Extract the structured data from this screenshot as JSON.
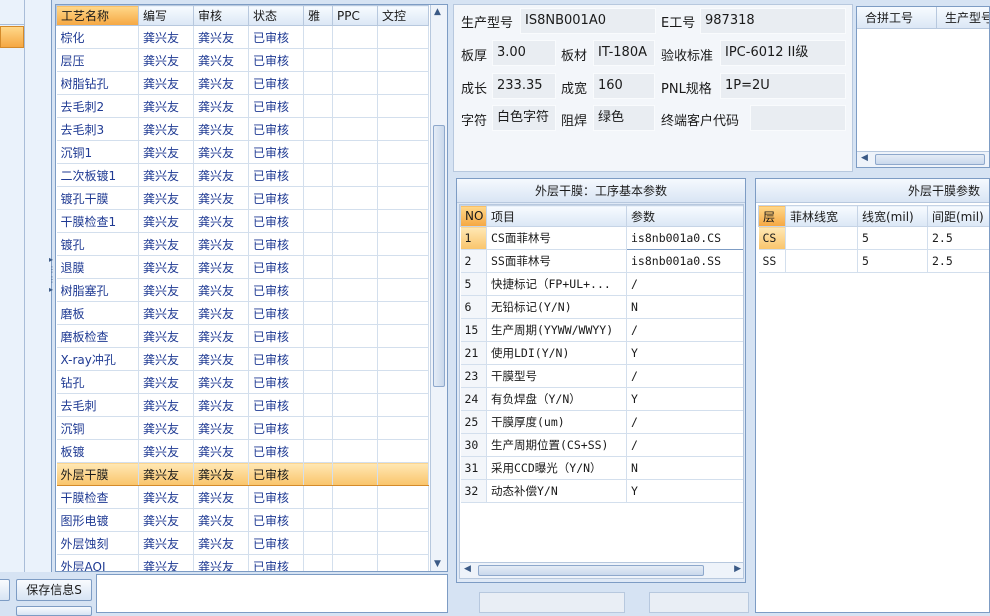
{
  "process_table": {
    "columns": [
      "工艺名称",
      "编写",
      "审核",
      "状态",
      "雅",
      "PPC",
      "文控"
    ],
    "rows": [
      {
        "name": "棕化",
        "writer": "龚兴友",
        "reviewer": "龚兴友",
        "status": "已审核"
      },
      {
        "name": "层压",
        "writer": "龚兴友",
        "reviewer": "龚兴友",
        "status": "已审核"
      },
      {
        "name": "树脂钻孔",
        "writer": "龚兴友",
        "reviewer": "龚兴友",
        "status": "已审核"
      },
      {
        "name": "去毛刺2",
        "writer": "龚兴友",
        "reviewer": "龚兴友",
        "status": "已审核"
      },
      {
        "name": "去毛刺3",
        "writer": "龚兴友",
        "reviewer": "龚兴友",
        "status": "已审核"
      },
      {
        "name": "沉铜1",
        "writer": "龚兴友",
        "reviewer": "龚兴友",
        "status": "已审核"
      },
      {
        "name": "二次板镀1",
        "writer": "龚兴友",
        "reviewer": "龚兴友",
        "status": "已审核"
      },
      {
        "name": "镀孔干膜",
        "writer": "龚兴友",
        "reviewer": "龚兴友",
        "status": "已审核"
      },
      {
        "name": "干膜检查1",
        "writer": "龚兴友",
        "reviewer": "龚兴友",
        "status": "已审核"
      },
      {
        "name": "镀孔",
        "writer": "龚兴友",
        "reviewer": "龚兴友",
        "status": "已审核"
      },
      {
        "name": "退膜",
        "writer": "龚兴友",
        "reviewer": "龚兴友",
        "status": "已审核"
      },
      {
        "name": "树脂塞孔",
        "writer": "龚兴友",
        "reviewer": "龚兴友",
        "status": "已审核"
      },
      {
        "name": "磨板",
        "writer": "龚兴友",
        "reviewer": "龚兴友",
        "status": "已审核"
      },
      {
        "name": "磨板检查",
        "writer": "龚兴友",
        "reviewer": "龚兴友",
        "status": "已审核"
      },
      {
        "name": "X-ray冲孔",
        "writer": "龚兴友",
        "reviewer": "龚兴友",
        "status": "已审核"
      },
      {
        "name": "钻孔",
        "writer": "龚兴友",
        "reviewer": "龚兴友",
        "status": "已审核"
      },
      {
        "name": "去毛刺",
        "writer": "龚兴友",
        "reviewer": "龚兴友",
        "status": "已审核"
      },
      {
        "name": "沉铜",
        "writer": "龚兴友",
        "reviewer": "龚兴友",
        "status": "已审核"
      },
      {
        "name": "板镀",
        "writer": "龚兴友",
        "reviewer": "龚兴友",
        "status": "已审核"
      },
      {
        "name": "外层干膜",
        "writer": "龚兴友",
        "reviewer": "龚兴友",
        "status": "已审核",
        "selected": true
      },
      {
        "name": "干膜检查",
        "writer": "龚兴友",
        "reviewer": "龚兴友",
        "status": "已审核"
      },
      {
        "name": "图形电镀",
        "writer": "龚兴友",
        "reviewer": "龚兴友",
        "status": "已审核"
      },
      {
        "name": "外层蚀刻",
        "writer": "龚兴友",
        "reviewer": "龚兴友",
        "status": "已审核"
      },
      {
        "name": "外层AOI",
        "writer": "龚兴友",
        "reviewer": "龚兴友",
        "status": "已审核"
      }
    ]
  },
  "bottom_left": {
    "save_info_label": "保存信息S"
  },
  "info": {
    "model_label": "生产型号",
    "model_value": "IS8NB001A0",
    "e_label": "E工号",
    "e_value": "987318",
    "thickness_label": "板厚",
    "thickness_value": "3.00",
    "material_label": "板材",
    "material_value": "IT-180A",
    "standard_label": "验收标准",
    "standard_value": "IPC-6012 II级",
    "length_label": "成长",
    "length_value": "233.35",
    "width_label": "成宽",
    "width_value": "160",
    "pnl_label": "PNL规格",
    "pnl_value": "1P=2U",
    "char_label": "字符",
    "char_value": "白色字符",
    "mask_label": "阻焊",
    "mask_value": "绿色",
    "customer_label": "终端客户代码",
    "customer_value": ""
  },
  "combine": {
    "col1": "合拼工号",
    "col2": "生产型号"
  },
  "dry_film": {
    "title": "外层干膜：工序基本参数",
    "columns": [
      "NO",
      "项目",
      "参数"
    ],
    "rows": [
      {
        "no": "1",
        "item": "CS面菲林号",
        "param": "is8nb001a0.CS"
      },
      {
        "no": "2",
        "item": "SS面菲林号",
        "param": "is8nb001a0.SS"
      },
      {
        "no": "5",
        "item": "快捷标记（FP+UL+...",
        "param": "/"
      },
      {
        "no": "6",
        "item": "无铅标记(Y/N)",
        "param": "N"
      },
      {
        "no": "15",
        "item": "生产周期(YYWW/WWYY)",
        "param": "/"
      },
      {
        "no": "21",
        "item": "使用LDI(Y/N)",
        "param": "Y"
      },
      {
        "no": "23",
        "item": "干膜型号",
        "param": "/"
      },
      {
        "no": "24",
        "item": "有负焊盘（Y/N）",
        "param": "Y"
      },
      {
        "no": "25",
        "item": "干膜厚度(um)",
        "param": "/"
      },
      {
        "no": "30",
        "item": "生产周期位置(CS+SS)",
        "param": "/"
      },
      {
        "no": "31",
        "item": "采用CCD曝光（Y/N）",
        "param": "N"
      },
      {
        "no": "32",
        "item": "动态补偿Y/N",
        "param": "Y"
      }
    ]
  },
  "outer_film": {
    "title": "外层干膜参数",
    "columns": [
      "层",
      "菲林线宽",
      "线宽(mil)",
      "间距(mil)"
    ],
    "rows": [
      {
        "layer": "CS",
        "film": "",
        "width": "5",
        "spacing": "2.5"
      },
      {
        "layer": "SS",
        "film": "",
        "width": "5",
        "spacing": "2.5"
      }
    ]
  }
}
